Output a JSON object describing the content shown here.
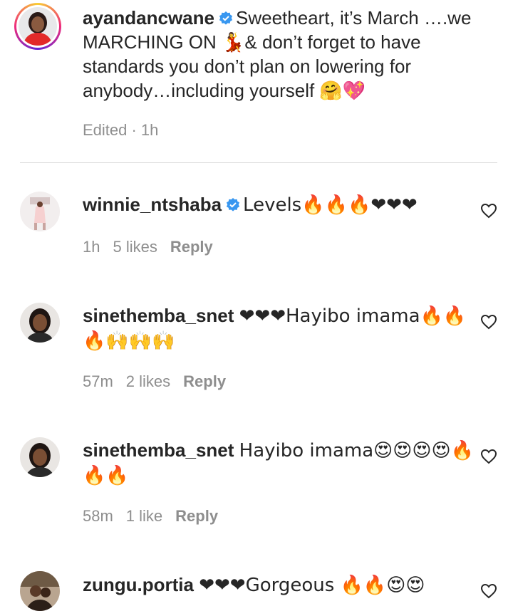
{
  "caption": {
    "username": "ayandancwane",
    "text": "Sweetheart, it’s March ….we MARCHING ON 💃& don’t forget to have standards you don’t plan on lowering for anybody…including yourself 🤗💖",
    "meta": "Edited · 1h"
  },
  "comments": [
    {
      "username": "winnie_ntshaba",
      "verified": true,
      "text": "Levels🔥🔥🔥❤❤❤",
      "time": "1h",
      "likes": "5 likes",
      "reply": "Reply"
    },
    {
      "username": "sinethemba_snet",
      "verified": false,
      "text": "❤❤❤Hayibo imama🔥🔥🔥🙌🙌🙌",
      "time": "57m",
      "likes": "2 likes",
      "reply": "Reply"
    },
    {
      "username": "sinethemba_snet",
      "verified": false,
      "text": "Hayibo imama😍😍😍😍🔥🔥🔥",
      "time": "58m",
      "likes": "1 like",
      "reply": "Reply"
    },
    {
      "username": "zungu.portia",
      "verified": false,
      "text": "❤❤❤Gorgeous 🔥🔥😍😍",
      "time": "",
      "likes": "",
      "reply": ""
    }
  ],
  "colors": {
    "verified_blue": "#3897f0",
    "meta_gray": "#8e8e8e",
    "text": "#262626"
  }
}
